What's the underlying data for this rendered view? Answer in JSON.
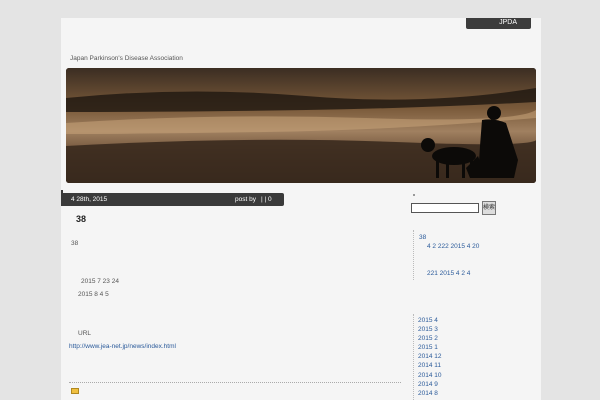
{
  "header": {
    "top_link": "JPDA",
    "site_description": "Japan Parkinson's Disease Association"
  },
  "post": {
    "date": "4  28th, 2015",
    "posted_by": "post by",
    "meta": "| | 0",
    "title": "38",
    "lines": [
      "38",
      "2015 7 23    24",
      "2015 8 4     5",
      "URL"
    ],
    "link": "http://www.jea-net.jp/news/index.html"
  },
  "search": {
    "button_label": "検索",
    "placeholder": ""
  },
  "sidebar": {
    "recent_title": "38",
    "recent_entry": "4  2  222  2015 4 20",
    "recent_entry2": "221  2015 4 2    4",
    "archives": [
      "2015 4",
      "2015 3",
      "2015 2",
      "2015 1",
      "2014 12",
      "2014 11",
      "2014 10",
      "2014 9",
      "2014 8"
    ]
  },
  "colors": {
    "bar_bg": "#3a3a3a",
    "link": "#2a5a9a",
    "page_bg": "#f5f5f5",
    "body_bg": "#e4e4e4"
  }
}
